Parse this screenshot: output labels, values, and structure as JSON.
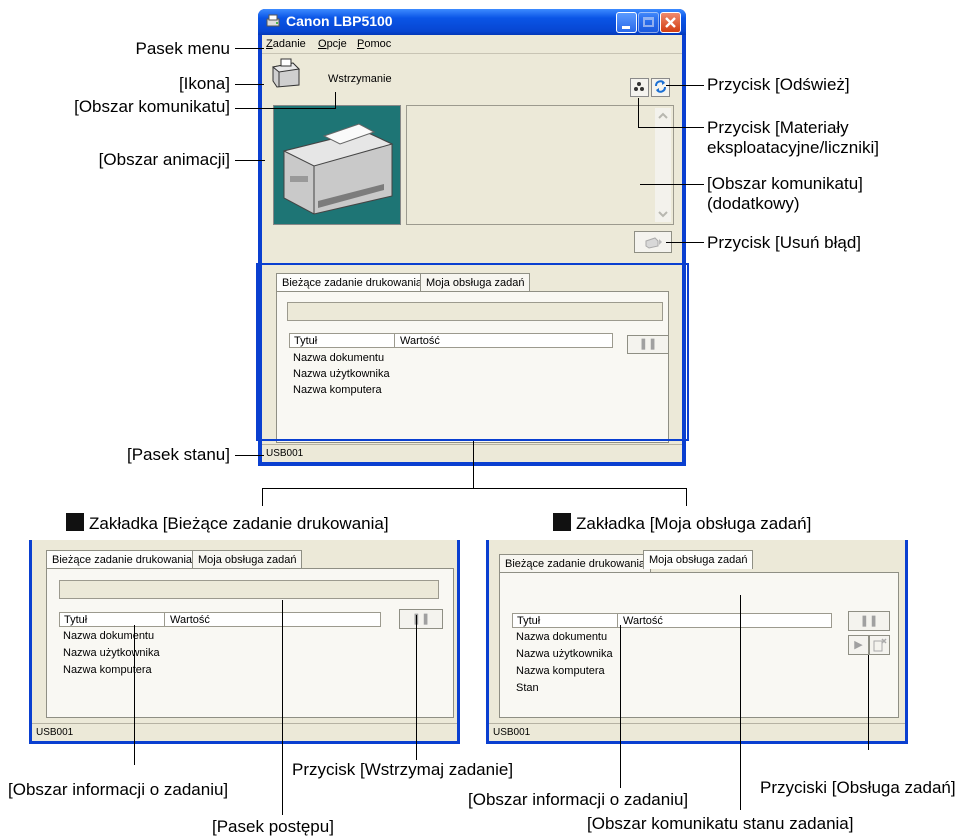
{
  "window": {
    "title": "Canon LBP5100",
    "menu": [
      "Zadanie",
      "Opcje",
      "Pomoc"
    ],
    "status_message": "Wstrzymanie",
    "status_bar": "USB001"
  },
  "tabs": {
    "current_job": "Bieżące zadanie drukowania",
    "my_jobs": "Moja obsługa zadań"
  },
  "table": {
    "col_title": "Tytuł",
    "col_value": "Wartość",
    "rows_current": [
      "Nazwa dokumentu",
      "Nazwa użytkownika",
      "Nazwa komputera"
    ],
    "rows_my": [
      "Nazwa dokumentu",
      "Nazwa użytkownika",
      "Nazwa komputera",
      "Stan"
    ]
  },
  "callouts": {
    "menu_bar": "Pasek menu",
    "icon": "[Ikona]",
    "message_area": "[Obszar komunikatu]",
    "animation_area": "[Obszar animacji]",
    "status_bar": "[Pasek stanu]",
    "refresh_button": "Przycisk [Odśwież]",
    "consumables_line1": "Przycisk [Materiały",
    "consumables_line2": "eksploatacyjne/liczniki]",
    "message_extra_line1": "[Obszar komunikatu]",
    "message_extra_line2": "(dodatkowy)",
    "clear_error_button": "Przycisk [Usuń błąd]",
    "tab_current_heading": "Zakładka [Bieżące zadanie drukowania]",
    "tab_my_heading": "Zakładka [Moja obsługa zadań]",
    "job_info_area": "[Obszar informacji o zadaniu]",
    "pause_job_button": "Przycisk [Wstrzymaj zadanie]",
    "progress_bar": "[Pasek postępu]",
    "job_info_area_2": "[Obszar informacji o zadaniu]",
    "job_operation_buttons": "Przyciski [Obsługa zadań]",
    "job_status_message_area": "[Obszar komunikatu stanu zadania]"
  },
  "colors": {
    "xp_blue": "#0a3fd0",
    "panel_bg": "#ece9d8",
    "animation_bg": "#1e7575"
  }
}
